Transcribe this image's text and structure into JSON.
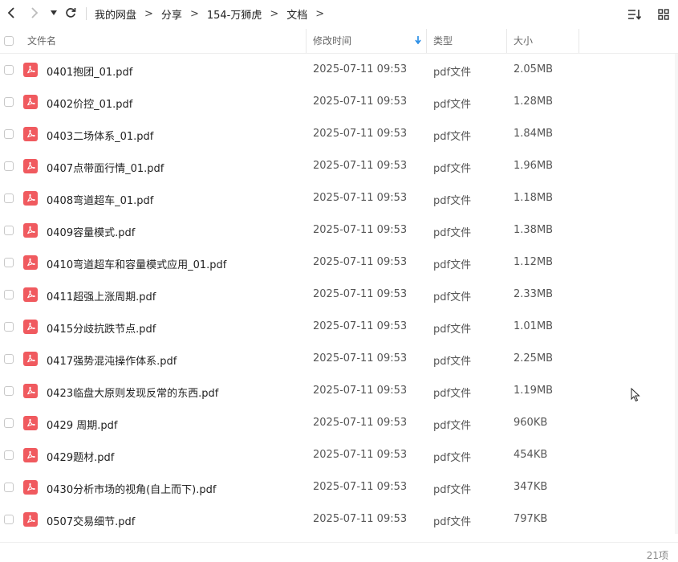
{
  "toolbar": {
    "breadcrumbs": [
      "我的网盘",
      "分享",
      "154-万狮虎",
      "文档"
    ]
  },
  "columns": {
    "name": "文件名",
    "modified": "修改时间",
    "type": "类型",
    "size": "大小"
  },
  "files": [
    {
      "name": "0401抱团_01.pdf",
      "modified": "2025-07-11 09:53",
      "type": "pdf文件",
      "size": "2.05MB"
    },
    {
      "name": "0402价控_01.pdf",
      "modified": "2025-07-11 09:53",
      "type": "pdf文件",
      "size": "1.28MB"
    },
    {
      "name": "0403二场体系_01.pdf",
      "modified": "2025-07-11 09:53",
      "type": "pdf文件",
      "size": "1.84MB"
    },
    {
      "name": "0407点带面行情_01.pdf",
      "modified": "2025-07-11 09:53",
      "type": "pdf文件",
      "size": "1.96MB"
    },
    {
      "name": "0408弯道超车_01.pdf",
      "modified": "2025-07-11 09:53",
      "type": "pdf文件",
      "size": "1.18MB"
    },
    {
      "name": "0409容量模式.pdf",
      "modified": "2025-07-11 09:53",
      "type": "pdf文件",
      "size": "1.38MB"
    },
    {
      "name": "0410弯道超车和容量模式应用_01.pdf",
      "modified": "2025-07-11 09:53",
      "type": "pdf文件",
      "size": "1.12MB"
    },
    {
      "name": "0411超强上涨周期.pdf",
      "modified": "2025-07-11 09:53",
      "type": "pdf文件",
      "size": "2.33MB"
    },
    {
      "name": "0415分歧抗跌节点.pdf",
      "modified": "2025-07-11 09:53",
      "type": "pdf文件",
      "size": "1.01MB"
    },
    {
      "name": "0417强势混沌操作体系.pdf",
      "modified": "2025-07-11 09:53",
      "type": "pdf文件",
      "size": "2.25MB"
    },
    {
      "name": "0423临盘大原则发现反常的东西.pdf",
      "modified": "2025-07-11 09:53",
      "type": "pdf文件",
      "size": "1.19MB"
    },
    {
      "name": "0429 周期.pdf",
      "modified": "2025-07-11 09:53",
      "type": "pdf文件",
      "size": "960KB"
    },
    {
      "name": "0429题材.pdf",
      "modified": "2025-07-11 09:53",
      "type": "pdf文件",
      "size": "454KB"
    },
    {
      "name": "0430分析市场的视角(自上而下).pdf",
      "modified": "2025-07-11 09:53",
      "type": "pdf文件",
      "size": "347KB"
    },
    {
      "name": "0507交易细节.pdf",
      "modified": "2025-07-11 09:53",
      "type": "pdf文件",
      "size": "797KB"
    }
  ],
  "footer": {
    "count": "21项"
  },
  "colors": {
    "pdf": "#f05a5f",
    "sort_arrow": "#1e88e5"
  },
  "icons": [
    "back-arrow-icon",
    "forward-arrow-icon",
    "history-dropdown-icon",
    "refresh-icon",
    "sort-list-icon",
    "grid-view-icon",
    "pdf-file-icon",
    "sort-desc-icon"
  ]
}
